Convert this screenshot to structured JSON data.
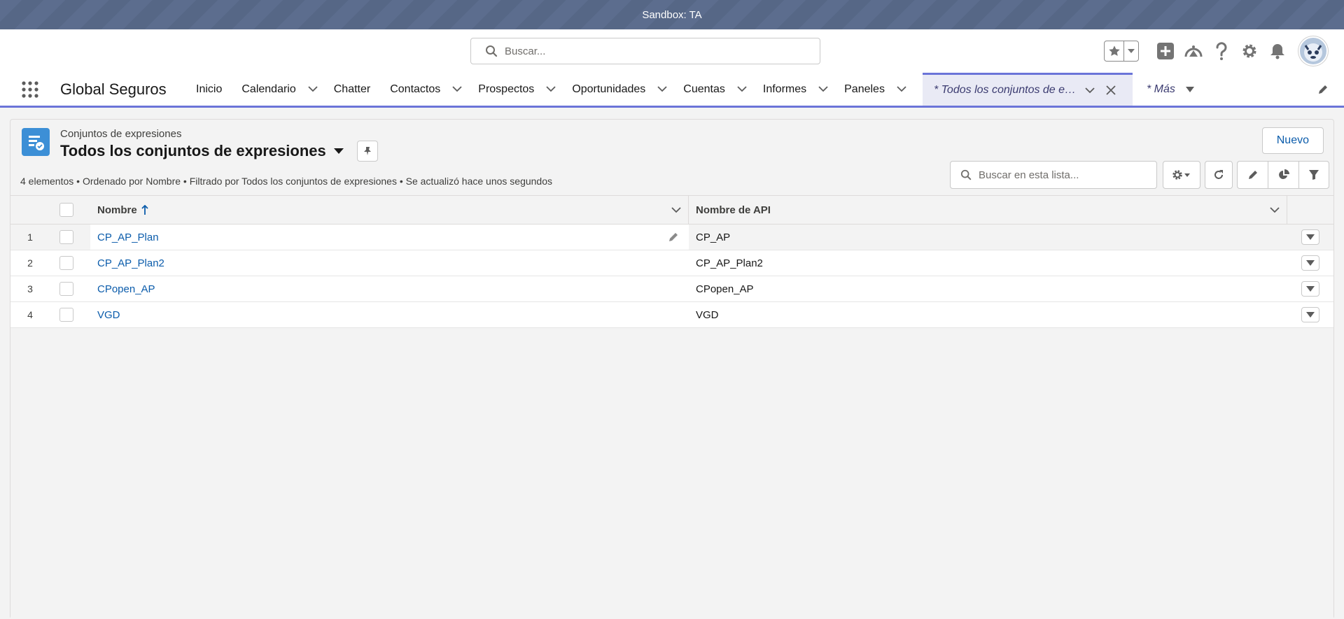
{
  "sandbox": {
    "label": "Sandbox: TA"
  },
  "global_search": {
    "placeholder": "Buscar..."
  },
  "app": {
    "name": "Global Seguros"
  },
  "nav": {
    "items": [
      {
        "label": "Inicio",
        "has_menu": false
      },
      {
        "label": "Calendario",
        "has_menu": true
      },
      {
        "label": "Chatter",
        "has_menu": false
      },
      {
        "label": "Contactos",
        "has_menu": true
      },
      {
        "label": "Prospectos",
        "has_menu": true
      },
      {
        "label": "Oportunidades",
        "has_menu": true
      },
      {
        "label": "Cuentas",
        "has_menu": true
      },
      {
        "label": "Informes",
        "has_menu": true
      },
      {
        "label": "Paneles",
        "has_menu": true
      }
    ],
    "active_tab": "* Todos los conjuntos de expresiones",
    "more": "* Más"
  },
  "list_view": {
    "object_label": "Conjuntos de expresiones",
    "title": "Todos los conjuntos de expresiones",
    "new_button": "Nuevo",
    "info": "4 elementos • Ordenado por Nombre • Filtrado por Todos los conjuntos de expresiones • Se actualizó hace unos segundos",
    "search_placeholder": "Buscar en esta lista...",
    "columns": {
      "name": "Nombre",
      "api": "Nombre de API"
    },
    "rows": [
      {
        "num": "1",
        "name": "CP_AP_Plan",
        "api": "CP_AP"
      },
      {
        "num": "2",
        "name": "CP_AP_Plan2",
        "api": "CP_AP_Plan2"
      },
      {
        "num": "3",
        "name": "CPopen_AP",
        "api": "CPopen_AP"
      },
      {
        "num": "4",
        "name": "VGD",
        "api": "VGD"
      }
    ]
  },
  "colors": {
    "brand": "#0b5cab",
    "active_tab_bar": "#6b74d8",
    "object_icon": "#3c8fd6",
    "sandbox_bar": "#5a6b8c"
  },
  "icons": [
    "search-icon",
    "star-icon",
    "plus-icon",
    "trailhead-icon",
    "help-icon",
    "gear-icon",
    "bell-icon",
    "app-launcher-icon",
    "pin-icon",
    "refresh-icon",
    "pencil-icon",
    "chart-icon",
    "filter-icon"
  ]
}
